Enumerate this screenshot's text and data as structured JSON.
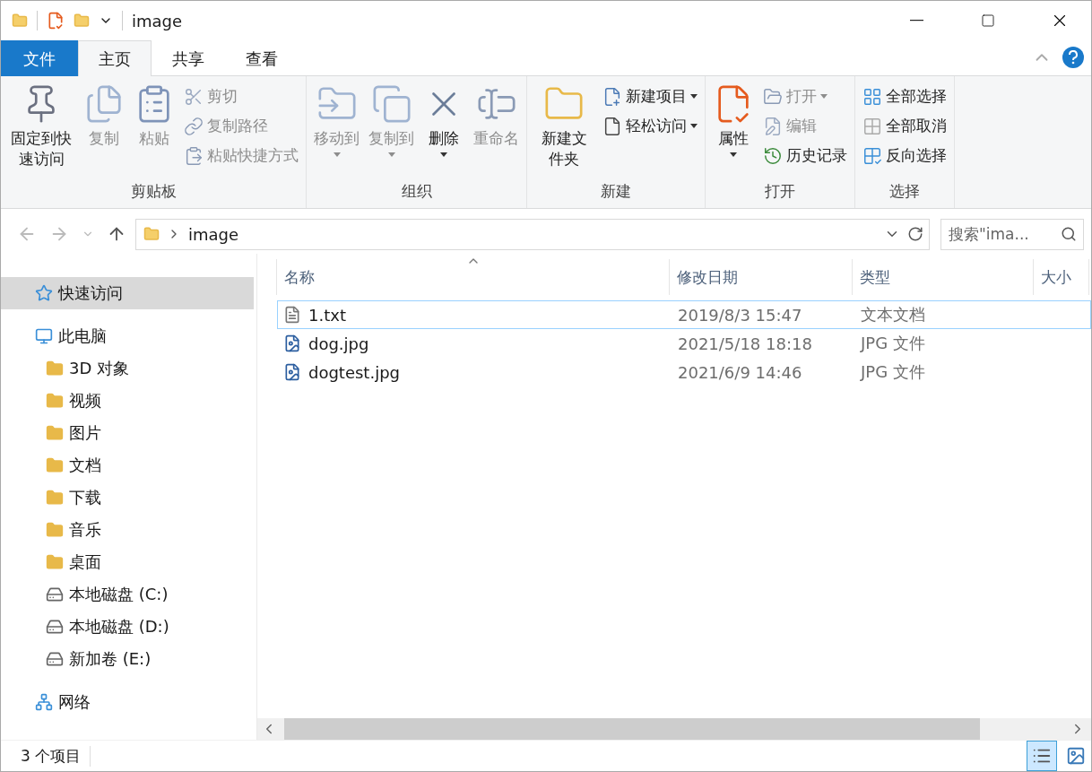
{
  "title_bar": {
    "title": "image"
  },
  "ribbon": {
    "tabs": [
      {
        "label": "文件",
        "kind": "file",
        "selected": false
      },
      {
        "label": "主页",
        "kind": "tab",
        "selected": true
      },
      {
        "label": "共享",
        "kind": "tab",
        "selected": false
      },
      {
        "label": "查看",
        "kind": "tab",
        "selected": false
      }
    ],
    "groups": [
      {
        "label": "剪贴板",
        "items": [
          {
            "label": "固定到快速访问",
            "kind": "large",
            "disabled": false,
            "dropdown": false
          },
          {
            "label": "复制",
            "kind": "large",
            "disabled": true,
            "dropdown": false
          },
          {
            "label": "粘贴",
            "kind": "large",
            "disabled": true,
            "dropdown": false
          },
          {
            "label": "剪切",
            "kind": "small",
            "disabled": true,
            "dropdown": false
          },
          {
            "label": "复制路径",
            "kind": "small",
            "disabled": true,
            "dropdown": false
          },
          {
            "label": "粘贴快捷方式",
            "kind": "small",
            "disabled": true,
            "dropdown": false
          }
        ]
      },
      {
        "label": "组织",
        "items": [
          {
            "label": "移动到",
            "kind": "large",
            "disabled": true,
            "dropdown": true
          },
          {
            "label": "复制到",
            "kind": "large",
            "disabled": true,
            "dropdown": true
          },
          {
            "label": "删除",
            "kind": "large",
            "disabled": false,
            "dropdown": true
          },
          {
            "label": "重命名",
            "kind": "large",
            "disabled": true,
            "dropdown": false
          }
        ]
      },
      {
        "label": "新建",
        "items": [
          {
            "label": "新建文件夹",
            "kind": "large",
            "disabled": false,
            "dropdown": false
          },
          {
            "label": "新建项目",
            "kind": "small",
            "disabled": false,
            "dropdown": true
          },
          {
            "label": "轻松访问",
            "kind": "small",
            "disabled": false,
            "dropdown": true
          }
        ]
      },
      {
        "label": "打开",
        "items": [
          {
            "label": "属性",
            "kind": "large",
            "disabled": false,
            "dropdown": true
          },
          {
            "label": "打开",
            "kind": "small",
            "disabled": true,
            "dropdown": true
          },
          {
            "label": "编辑",
            "kind": "small",
            "disabled": true,
            "dropdown": false
          },
          {
            "label": "历史记录",
            "kind": "small",
            "disabled": false,
            "dropdown": false
          }
        ]
      },
      {
        "label": "选择",
        "items": [
          {
            "label": "全部选择",
            "kind": "small",
            "disabled": false,
            "dropdown": false
          },
          {
            "label": "全部取消",
            "kind": "small",
            "disabled": false,
            "dropdown": false
          },
          {
            "label": "反向选择",
            "kind": "small",
            "disabled": false,
            "dropdown": false
          }
        ]
      }
    ]
  },
  "address_bar": {
    "path": "image",
    "search": {
      "placeholder": "搜索\"ima..."
    }
  },
  "sidebar": {
    "items": [
      {
        "label": "快速访问",
        "selected": true
      },
      {
        "label": "此电脑",
        "selected": false,
        "children": [
          {
            "label": "3D 对象",
            "selected": false
          },
          {
            "label": "视频",
            "selected": false
          },
          {
            "label": "图片",
            "selected": false
          },
          {
            "label": "文档",
            "selected": false
          },
          {
            "label": "下载",
            "selected": false
          },
          {
            "label": "音乐",
            "selected": false
          },
          {
            "label": "桌面",
            "selected": false
          },
          {
            "label": "本地磁盘 (C:)",
            "selected": false
          },
          {
            "label": "本地磁盘 (D:)",
            "selected": false
          },
          {
            "label": "新加卷 (E:)",
            "selected": false
          }
        ]
      },
      {
        "label": "网络",
        "selected": false
      }
    ]
  },
  "table": {
    "columns": [
      {
        "label": "名称",
        "sorted": true
      },
      {
        "label": "修改日期",
        "sorted": false
      },
      {
        "label": "类型",
        "sorted": false
      },
      {
        "label": "大小",
        "sorted": false
      }
    ],
    "rows": [
      {
        "kind": "text",
        "name": "1.txt",
        "modified": "2019/8/3 15:47",
        "type": "文本文档",
        "focused": true,
        "selected": false
      },
      {
        "kind": "image",
        "name": "dog.jpg",
        "modified": "2021/5/18 18:18",
        "type": "JPG 文件",
        "focused": false,
        "selected": false
      },
      {
        "kind": "image",
        "name": "dogtest.jpg",
        "modified": "2021/6/9 14:46",
        "type": "JPG 文件",
        "focused": false,
        "selected": false
      }
    ]
  },
  "status_bar": {
    "count": "3 个项目",
    "views": [
      {
        "selected": true
      },
      {
        "selected": false
      }
    ]
  }
}
